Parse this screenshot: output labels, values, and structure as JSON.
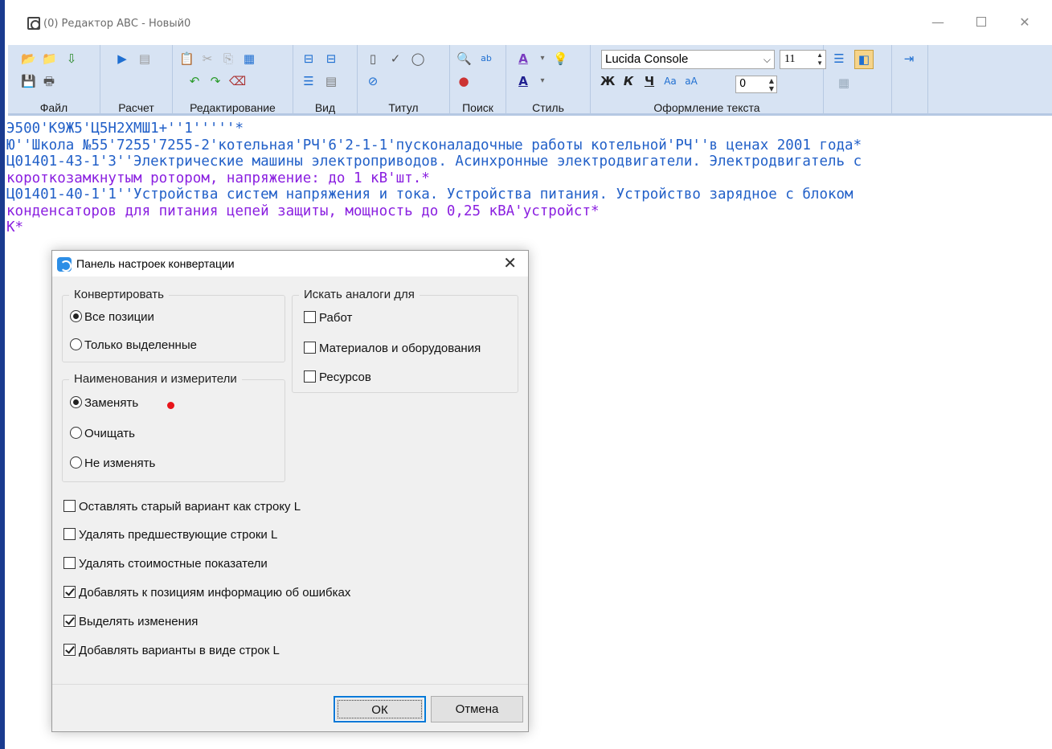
{
  "window": {
    "title": "(0) Редактор АВС - Новый0",
    "minimize": "—",
    "close": "✕"
  },
  "ribbon": {
    "groups": [
      {
        "label": "Файл"
      },
      {
        "label": "Расчет"
      },
      {
        "label": "Редактирование"
      },
      {
        "label": "Вид"
      },
      {
        "label": "Титул"
      },
      {
        "label": "Поиск"
      },
      {
        "label": "Стиль"
      },
      {
        "label": "Оформление текста"
      }
    ],
    "font_name": "Lucida Console",
    "font_size": "11",
    "spacing_value": "0",
    "bold": "Ж",
    "italic": "К",
    "underline": "Ч"
  },
  "editor": {
    "lines": [
      {
        "text": "Э500'К9Ж5'Ц5Н2ХМШ1+''1'''''*",
        "color": "#2260c8"
      },
      {
        "text": "Ю''Школа №55'7255'7255-2'котельная'РЧ'6'2-1-1'пусконаладочные работы котельной'РЧ''в ценах 2001 года*",
        "color": "#2260c8"
      },
      {
        "text": "Ц01401-43-1'3''Электрические машины электроприводов. Асинхронные электродвигатели. Электродвигатель с",
        "color": "#2260c8"
      },
      {
        "text": "короткозамкнутым ротором, напряжение: до 1 кВ'шт.*",
        "color": "#8a1fe0"
      },
      {
        "text": "Ц01401-40-1'1''Устройства систем напряжения и тока. Устройства питания. Устройство зарядное с блоком",
        "color": "#2260c8"
      },
      {
        "text": "конденсаторов для питания цепей защиты, мощность до 0,25 кВА'устройст*",
        "color": "#8a1fe0"
      },
      {
        "text": "К*",
        "color": "#8a1fe0"
      }
    ]
  },
  "dialog": {
    "title": "Панель настроек конвертации",
    "close": "✕",
    "convert": {
      "legend": "Конвертировать",
      "all": "Все позиции",
      "selected_only": "Только выделенные",
      "value": "all"
    },
    "analogs": {
      "legend": "Искать аналоги для",
      "works": "Работ",
      "materials": "Материалов и оборудования",
      "resources": "Ресурсов"
    },
    "names": {
      "legend": "Наименования и измерители",
      "replace": "Заменять",
      "clear": "Очищать",
      "keep": "Не изменять",
      "value": "replace"
    },
    "options": [
      {
        "label": "Оставлять старый вариант как строку L",
        "checked": false
      },
      {
        "label": "Удалять предшествующие строки L",
        "checked": false
      },
      {
        "label": "Удалять стоимостные показатели",
        "checked": false
      },
      {
        "label": "Добавлять к позициям информацию об ошибках",
        "checked": true
      },
      {
        "label": "Выделять изменения",
        "checked": true
      },
      {
        "label": "Добавлять варианты в виде строк L",
        "checked": true
      }
    ],
    "ok": "ОК",
    "cancel": "Отмена"
  }
}
